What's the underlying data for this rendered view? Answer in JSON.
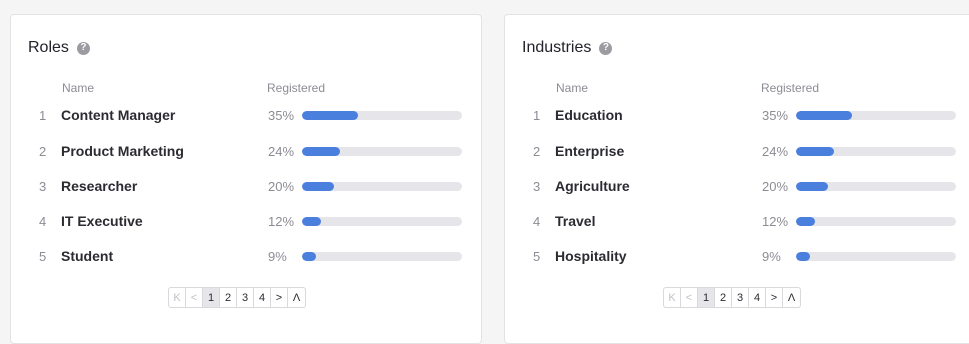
{
  "roles": {
    "title": "Roles",
    "col_name": "Name",
    "col_registered": "Registered",
    "rows": [
      {
        "index": "1",
        "name": "Content Manager",
        "pct_label": "35%",
        "value": 0.35
      },
      {
        "index": "2",
        "name": "Product Marketing",
        "pct_label": "24%",
        "value": 0.24
      },
      {
        "index": "3",
        "name": "Researcher",
        "pct_label": "20%",
        "value": 0.2
      },
      {
        "index": "4",
        "name": "IT Executive",
        "pct_label": "12%",
        "value": 0.12
      },
      {
        "index": "5",
        "name": "Student",
        "pct_label": "9%",
        "value": 0.09
      }
    ],
    "pagination": {
      "first": "K",
      "prev": "<",
      "pages": [
        "1",
        "2",
        "3",
        "4"
      ],
      "next": ">",
      "last": "Λ",
      "current": "1"
    }
  },
  "industries": {
    "title": "Industries",
    "col_name": "Name",
    "col_registered": "Registered",
    "rows": [
      {
        "index": "1",
        "name": "Education",
        "pct_label": "35%",
        "value": 0.35
      },
      {
        "index": "2",
        "name": "Enterprise",
        "pct_label": "24%",
        "value": 0.24
      },
      {
        "index": "3",
        "name": "Agriculture",
        "pct_label": "20%",
        "value": 0.2
      },
      {
        "index": "4",
        "name": "Travel",
        "pct_label": "12%",
        "value": 0.12
      },
      {
        "index": "5",
        "name": "Hospitality",
        "pct_label": "9%",
        "value": 0.09
      }
    ],
    "pagination": {
      "first": "K",
      "prev": "<",
      "pages": [
        "1",
        "2",
        "3",
        "4"
      ],
      "next": ">",
      "last": "Λ",
      "current": "1"
    }
  },
  "help_icon_glyph": "?",
  "colors": {
    "bar_fill": "#4a7fde",
    "bar_track": "#e6e6ea",
    "help_icon": "#9b9ba1"
  }
}
